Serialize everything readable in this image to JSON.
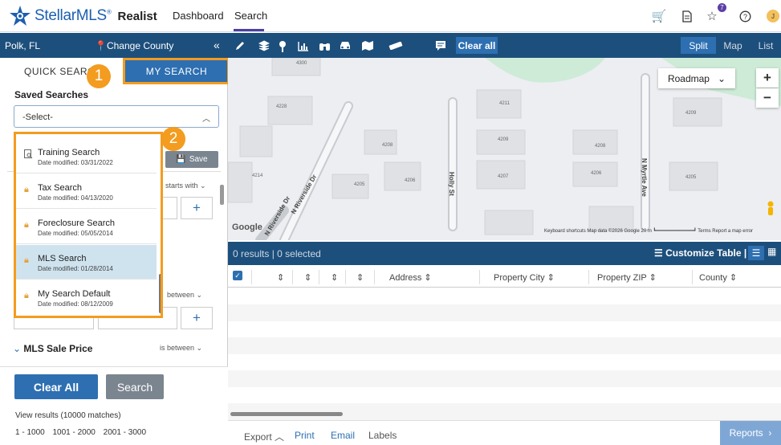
{
  "header": {
    "brand_name": "StellarMLS",
    "brand_reg": "®",
    "product": "Realist",
    "nav": [
      "Dashboard",
      "Search"
    ],
    "notification_count": "7",
    "avatar_initial": "J"
  },
  "toolbar": {
    "location": "Polk, FL",
    "change_county": "Change County",
    "collapse": "«",
    "clear_all": "Clear all",
    "views": [
      "Split",
      "Map",
      "List"
    ]
  },
  "left_panel": {
    "tab_quick": "QUICK SEARCH",
    "tab_my": "MY SEARCH",
    "callout_1": "1",
    "callout_2": "2",
    "saved_searches_title": "Saved Searches",
    "select_value": "-Select-",
    "save_button": "Save",
    "saved_searches": [
      {
        "name": "Training Search",
        "date": "Date modified: 03/31/2022"
      },
      {
        "name": "Tax Search",
        "date": "Date modified: 04/13/2020"
      },
      {
        "name": "Foreclosure Search",
        "date": "Date modified: 05/05/2014"
      },
      {
        "name": "MLS Search",
        "date": "Date modified: 01/28/2014"
      },
      {
        "name": "My Search Default",
        "date": "Date modified: 08/12/2009"
      }
    ],
    "filter_starts_with": "starts with",
    "filter_between": "between",
    "plus": "+",
    "sale_price_label": "MLS Sale Price",
    "sale_price_condition": "is between",
    "clear_all_button": "Clear All",
    "search_button": "Search",
    "view_results": "View results (10000 matches)",
    "pages": [
      "1 - 1000",
      "1001 - 2000",
      "2001 - 3000"
    ]
  },
  "map": {
    "roadmap": "Roadmap",
    "zoom_in": "+",
    "zoom_out": "−",
    "google": "Google",
    "attribution": "Keyboard shortcuts   Map data ©2026 Google   20 m ┗━━━━━━━━━━━━━┛   Terms   Report a map error",
    "streets": [
      "N Riverside Dr",
      "Holly St",
      "N Myrtle Ave",
      "N Riverside Dr"
    ],
    "lots": [
      "4300",
      "4228",
      "4211",
      "4209",
      "4208",
      "4209",
      "4208",
      "4214",
      "4205",
      "4206",
      "4207",
      "4206",
      "4205"
    ]
  },
  "table": {
    "results": "0 results",
    "selected": "0 selected",
    "customize": "Customize Table",
    "columns": [
      "Address",
      "Property City",
      "Property ZIP",
      "County"
    ],
    "sort_glyph": "⇕"
  },
  "bottom": {
    "export": "Export",
    "print": "Print",
    "email": "Email",
    "labels": "Labels",
    "reports": "Reports"
  },
  "colors": {
    "primary_dark": "#1d4f7c",
    "primary": "#2d6fb1",
    "highlight": "#f39c1f"
  }
}
